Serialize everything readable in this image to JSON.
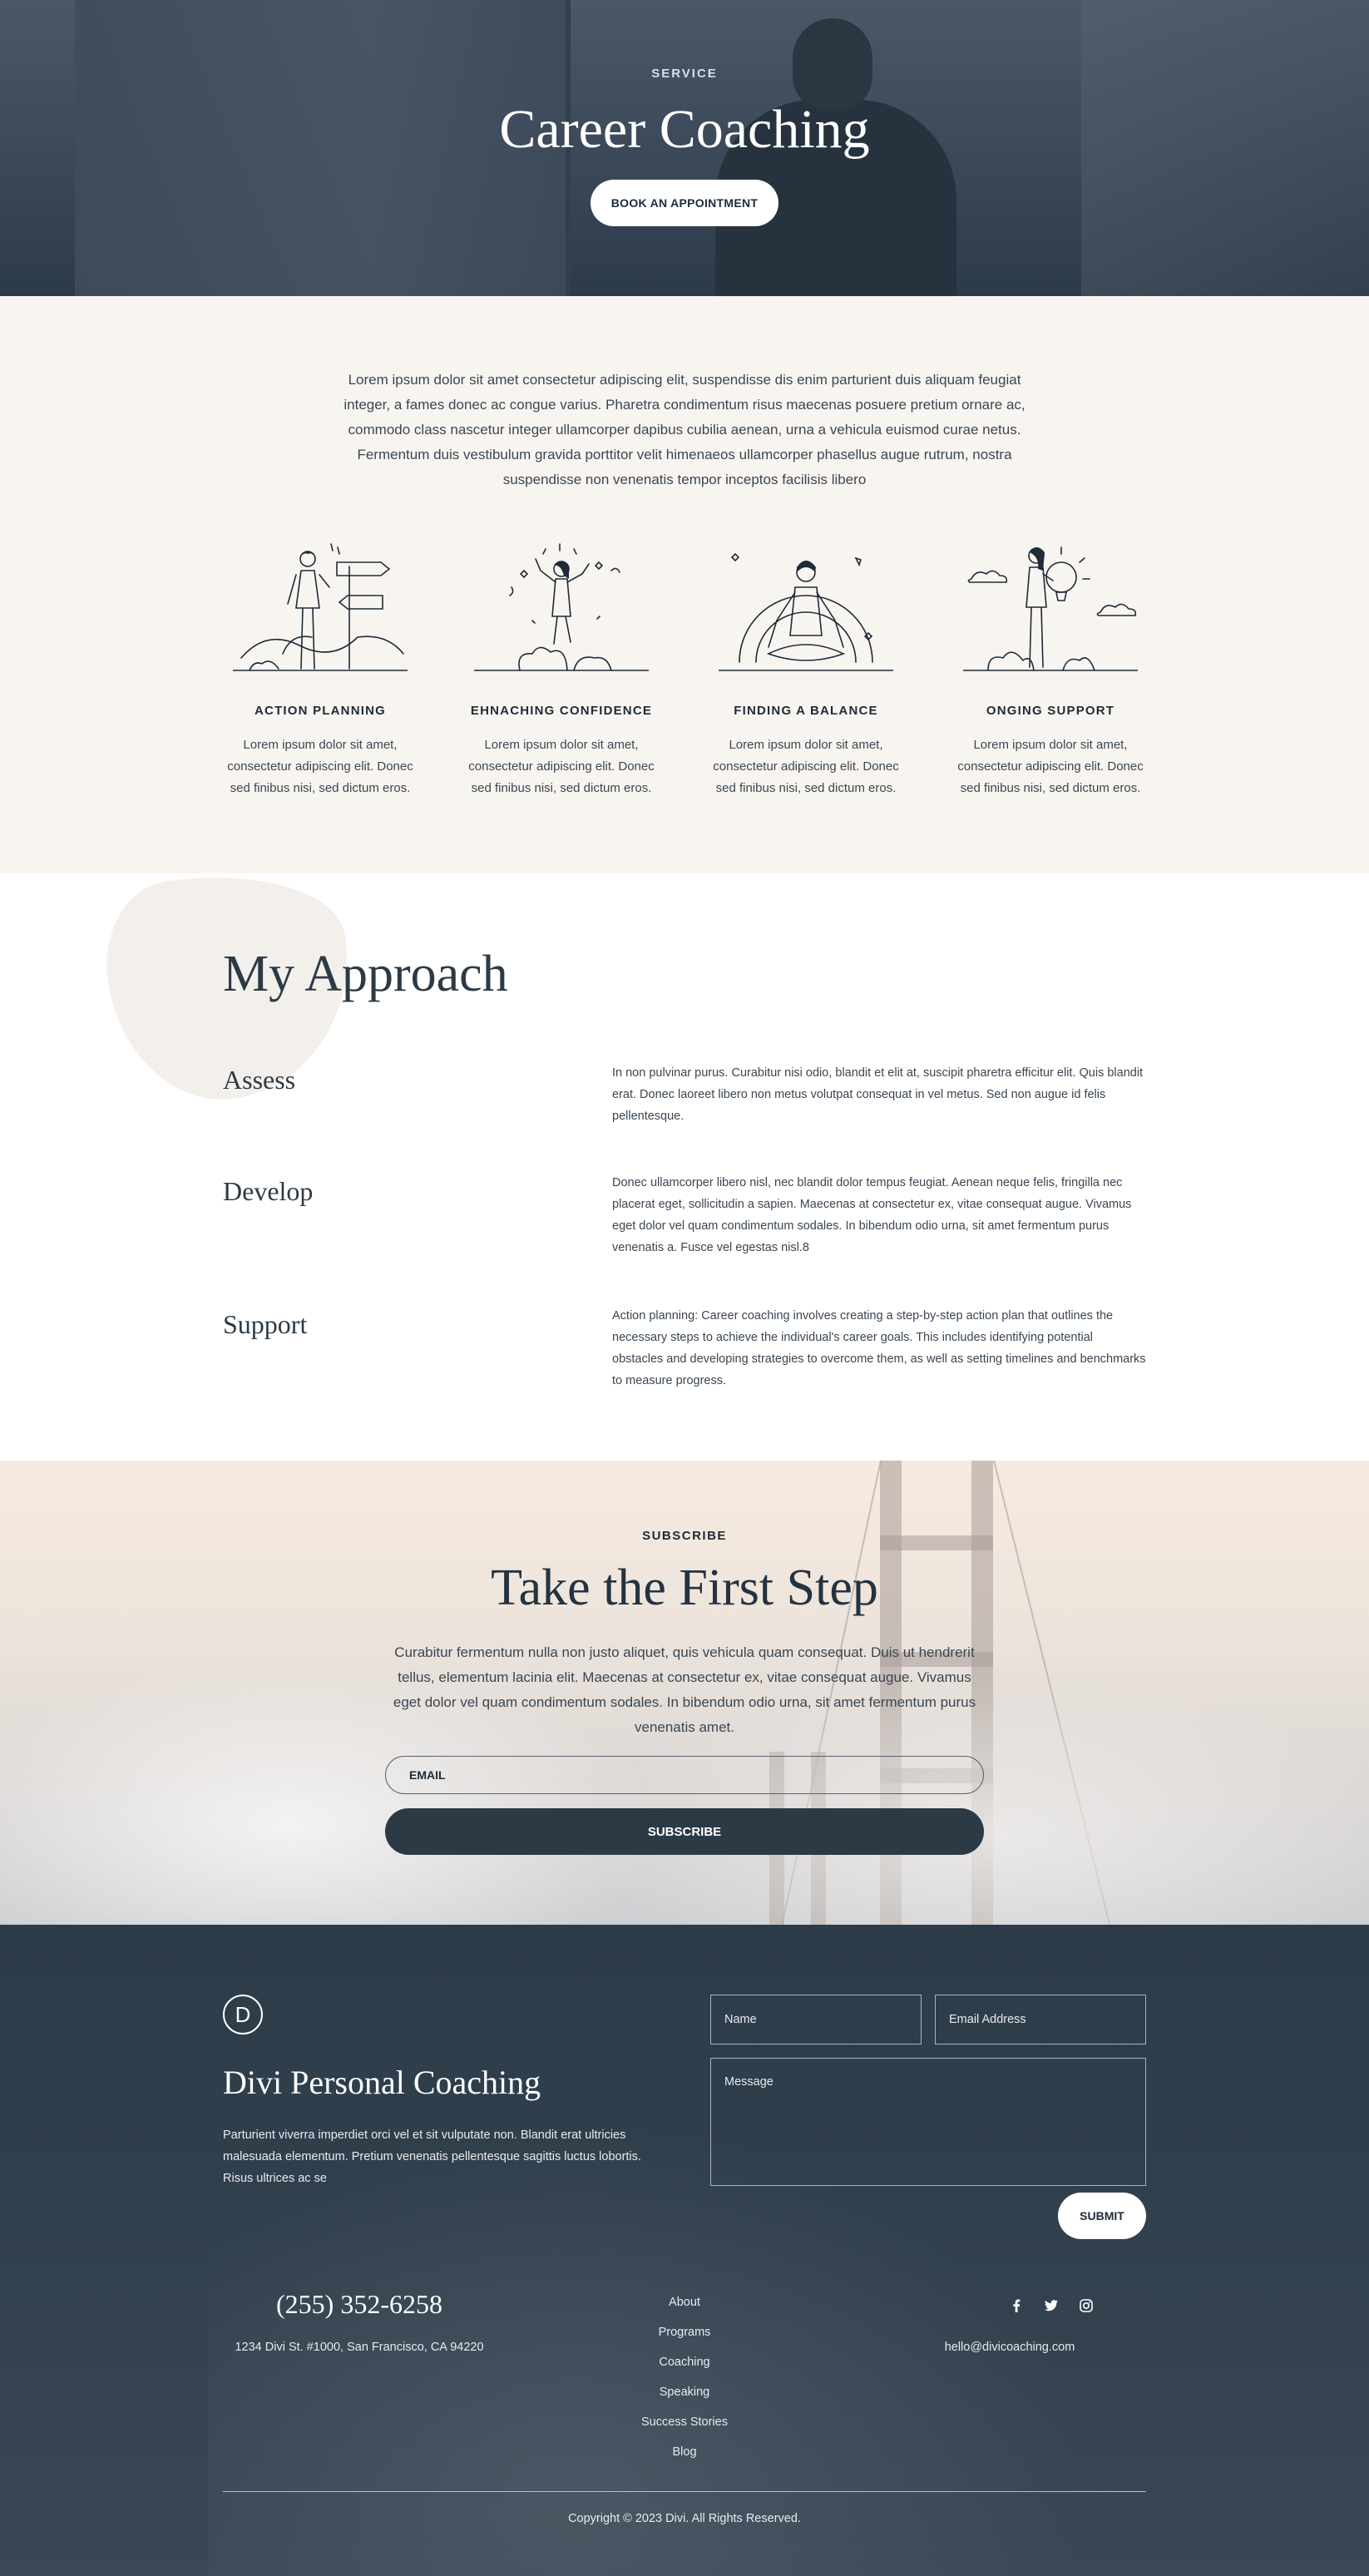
{
  "hero": {
    "kicker": "SERVICE",
    "title": "Career Coaching",
    "cta_label": "BOOK AN APPOINTMENT"
  },
  "intro": {
    "text": "Lorem ipsum dolor sit amet consectetur adipiscing elit, suspendisse dis enim parturient duis aliquam feugiat integer, a fames donec ac congue varius. Pharetra condimentum risus maecenas posuere pretium ornare ac, commodo class nascetur integer ullamcorper dapibus cubilia aenean, urna a vehicula euismod curae netus. Fermentum duis vestibulum gravida porttitor velit himenaeos ullamcorper phasellus augue rutrum, nostra suspendisse non venenatis tempor inceptos facilisis libero",
    "features": [
      {
        "title": "ACTION PLANNING",
        "text": "Lorem ipsum dolor sit amet, consectetur adipiscing elit. Donec sed finibus nisi, sed dictum eros.",
        "icon": "signpost-person-illustration"
      },
      {
        "title": "EHNACHING CONFIDENCE",
        "text": "Lorem ipsum dolor sit amet, consectetur adipiscing elit. Donec sed finibus nisi, sed dictum eros.",
        "icon": "jumping-person-illustration"
      },
      {
        "title": "FINDING A BALANCE",
        "text": "Lorem ipsum dolor sit amet, consectetur adipiscing elit. Donec sed finibus nisi, sed dictum eros.",
        "icon": "meditating-person-illustration"
      },
      {
        "title": "ONGING SUPPORT",
        "text": "Lorem ipsum dolor sit amet, consectetur adipiscing elit. Donec sed finibus nisi, sed dictum eros.",
        "icon": "lightbulb-person-illustration"
      }
    ]
  },
  "approach": {
    "title": "My Approach",
    "steps": [
      {
        "label": "Assess",
        "text": "In non pulvinar purus. Curabitur nisi odio, blandit et elit at, suscipit pharetra efficitur elit. Quis blandit erat. Donec laoreet libero non metus volutpat consequat in vel metus. Sed non augue id felis pellentesque."
      },
      {
        "label": "Develop",
        "text": "Donec ullamcorper libero nisl, nec blandit dolor tempus feugiat. Aenean neque felis, fringilla nec placerat eget, sollicitudin a sapien. Maecenas at consectetur ex, vitae consequat augue. Vivamus eget dolor vel quam condimentum sodales. In bibendum odio urna, sit amet fermentum purus venenatis a. Fusce vel egestas nisl.8"
      },
      {
        "label": "Support",
        "text": "Action planning: Career coaching involves creating a step-by-step action plan that outlines the necessary steps to achieve the individual's career goals. This includes identifying potential obstacles and developing strategies to overcome them, as well as setting timelines and benchmarks to measure progress."
      }
    ]
  },
  "subscribe": {
    "kicker": "SUBSCRIBE",
    "title": "Take the First Step",
    "text": "Curabitur fermentum nulla non justo aliquet, quis vehicula quam consequat. Duis ut hendrerit tellus, elementum lacinia elit. Maecenas at consectetur ex, vitae consequat augue. Vivamus eget dolor vel quam condimentum sodales. In bibendum odio urna, sit amet fermentum purus venenatis amet.",
    "email_placeholder": "EMAIL",
    "button_label": "SUBSCRIBE"
  },
  "footer": {
    "logo_letter": "D",
    "brand": "Divi Personal Coaching",
    "description": "Parturient viverra imperdiet orci vel et sit vulputate non. Blandit erat ultricies malesuada elementum. Pretium venenatis pellentesque sagittis luctus lobortis. Risus ultrices ac se",
    "form": {
      "name_placeholder": "Name",
      "email_placeholder": "Email Address",
      "message_placeholder": "Message",
      "submit_label": "SUBMIT"
    },
    "phone": "(255) 352-6258",
    "address": "1234 Divi St. #1000, San Francisco, CA 94220",
    "nav": [
      "About",
      "Programs",
      "Coaching",
      "Speaking",
      "Success Stories",
      "Blog"
    ],
    "social": [
      "facebook-icon",
      "twitter-icon",
      "instagram-icon"
    ],
    "email": "hello@divicoaching.com",
    "copyright": "Copyright © 2023 Divi. All Rights Reserved."
  },
  "colors": {
    "navy": "#2c3a46",
    "cream": "#f8f5f1",
    "white": "#ffffff"
  }
}
